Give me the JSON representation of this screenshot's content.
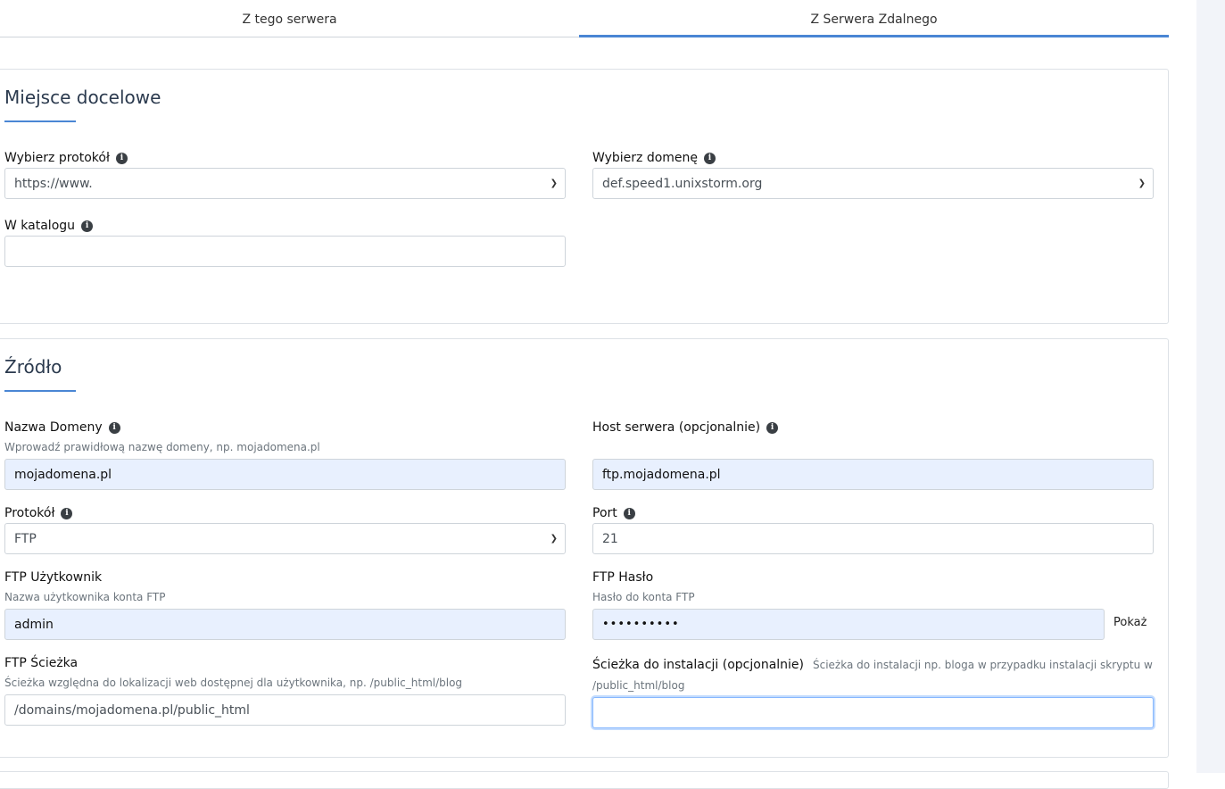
{
  "tabs": [
    {
      "label": "Z tego serwera"
    },
    {
      "label": "Z Serwera Zdalnego"
    }
  ],
  "destination": {
    "title": "Miejsce docelowe",
    "protocol_label": "Wybierz protokół",
    "protocol_value": "https://www.",
    "domain_label": "Wybierz domenę",
    "domain_value": "def.speed1.unixstorm.org",
    "directory_label": "W katalogu",
    "directory_value": ""
  },
  "source": {
    "title": "Źródło",
    "domain_label": "Nazwa Domeny",
    "domain_help": "Wprowadź prawidłową nazwę domeny, np. mojadomena.pl",
    "domain_value": "mojadomena.pl",
    "host_label": "Host serwera (opcjonalnie)",
    "host_value": "ftp.mojadomena.pl",
    "protocol_label": "Protokół",
    "protocol_value": "FTP",
    "port_label": "Port",
    "port_value": "21",
    "user_label": "FTP Użytkownik",
    "user_help": "Nazwa użytkownika konta FTP",
    "user_value": "admin",
    "pass_label": "FTP Hasło",
    "pass_help": "Hasło do konta FTP",
    "pass_value": "••••••••••",
    "show_label": "Pokaż",
    "path_label": "FTP Ścieżka",
    "path_help": "Ścieżka względna do lokalizacji web dostępnej dla użytkownika, np. /public_html/blog",
    "path_value": "/domains/mojadomena.pl/public_html",
    "install_label": "Ścieżka do instalacji (opcjonalnie)",
    "install_help_1": "Ścieżka do instalacji np. bloga w przypadku instalacji skryptu w",
    "install_help_2": "/public_html/blog",
    "install_value": ""
  },
  "icons": {
    "info": "i",
    "chevron": "chevron-down-icon"
  }
}
